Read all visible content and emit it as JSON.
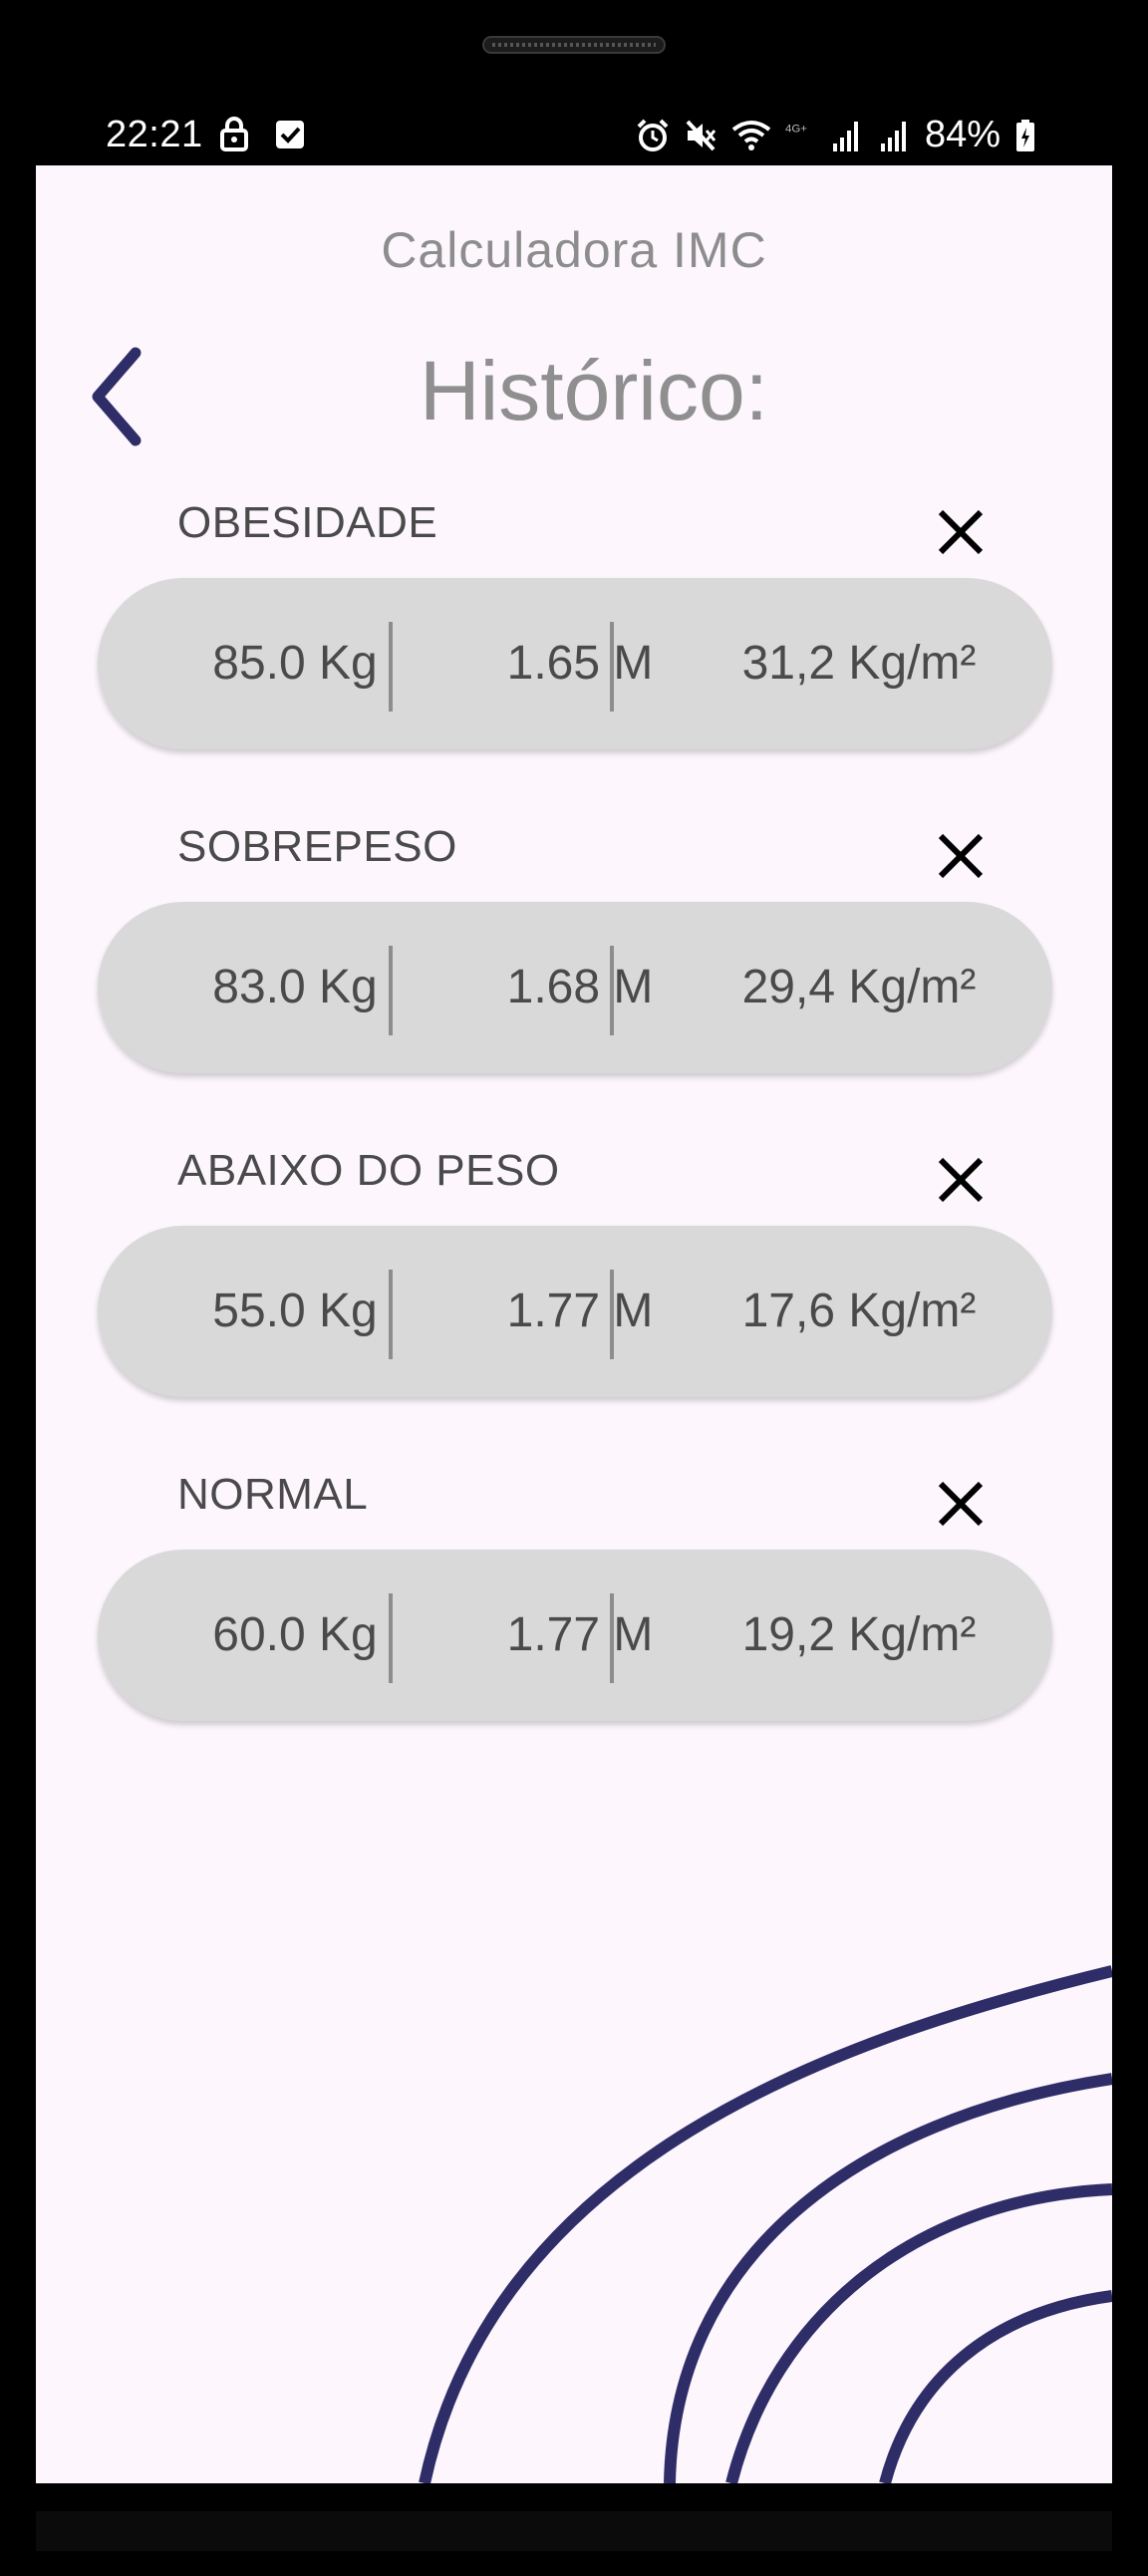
{
  "status_bar": {
    "time": "22:21",
    "battery": "84%",
    "left_icons": [
      "lock-icon",
      "checkbox-icon"
    ],
    "right_icons": [
      "alarm-icon",
      "mute-icon",
      "wifi-icon",
      "4g-icon",
      "signal-icon",
      "signal-icon",
      "battery-charging-icon"
    ]
  },
  "header": {
    "app_title": "Calculadora IMC",
    "page_title": "Histórico:"
  },
  "colors": {
    "background": "#fdf7fd",
    "accent": "#2f2d68",
    "pill": "#d9d9d9",
    "text": "#4a4a4a",
    "title": "#8f8f8f"
  },
  "history": [
    {
      "category": "OBESIDADE",
      "weight": "85.0 Kg",
      "height": "1.65 M",
      "imc": "31,2 Kg/m²"
    },
    {
      "category": "SOBREPESO",
      "weight": "83.0 Kg",
      "height": "1.68 M",
      "imc": "29,4 Kg/m²"
    },
    {
      "category": "ABAIXO DO PESO",
      "weight": "55.0 Kg",
      "height": "1.77 M",
      "imc": "17,6 Kg/m²"
    },
    {
      "category": "NORMAL",
      "weight": "60.0 Kg",
      "height": "1.77 M",
      "imc": "19,2 Kg/m²"
    }
  ]
}
